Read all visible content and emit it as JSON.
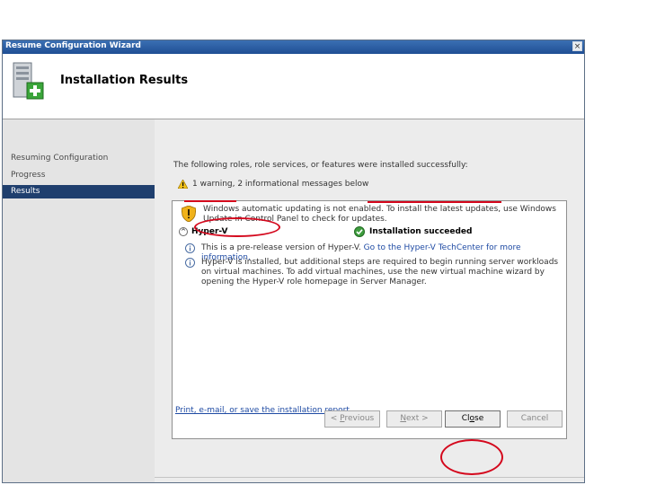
{
  "window": {
    "title": "Resume Configuration Wizard",
    "close_symbol": "×"
  },
  "header": {
    "title": "Installation Results",
    "icon": "server-add-icon"
  },
  "sidebar": {
    "items": [
      {
        "label": "Resuming Configuration",
        "active": false
      },
      {
        "label": "Progress",
        "active": false
      },
      {
        "label": "Results",
        "active": true
      }
    ]
  },
  "content": {
    "intro": "The following roles, role services, or features were installed successfully:",
    "summary": "1 warning, 2 informational messages below",
    "warning_message": "Windows automatic updating is not enabled. To install the latest updates, use Windows Update in Control Panel to check for updates.",
    "role": {
      "toggle": "^",
      "name": "Hyper-V",
      "status": "Installation succeeded"
    },
    "messages": [
      {
        "text": "This is a pre-release version of Hyper-V. ",
        "link": "Go to the Hyper-V TechCenter for more information."
      },
      {
        "text": "Hyper-V is installed, but additional steps are required to begin running server workloads on virtual machines. To add virtual machines, use the new virtual machine wizard by opening the Hyper-V role homepage in Server Manager.",
        "link": ""
      }
    ],
    "report_link": "Print, e-mail, or save the installation report"
  },
  "buttons": {
    "previous": {
      "prefix": "< ",
      "accel": "P",
      "rest": "revious"
    },
    "next": {
      "prefix": "",
      "accel": "N",
      "rest": "ext >"
    },
    "close": {
      "prefix": "Cl",
      "accel": "o",
      "rest": "se"
    },
    "cancel": "Cancel"
  },
  "colors": {
    "title_bar": "#1f4f94",
    "selected_nav": "#1f3f6e",
    "annotation_red": "#d4071c",
    "link": "#1e4aa3"
  }
}
